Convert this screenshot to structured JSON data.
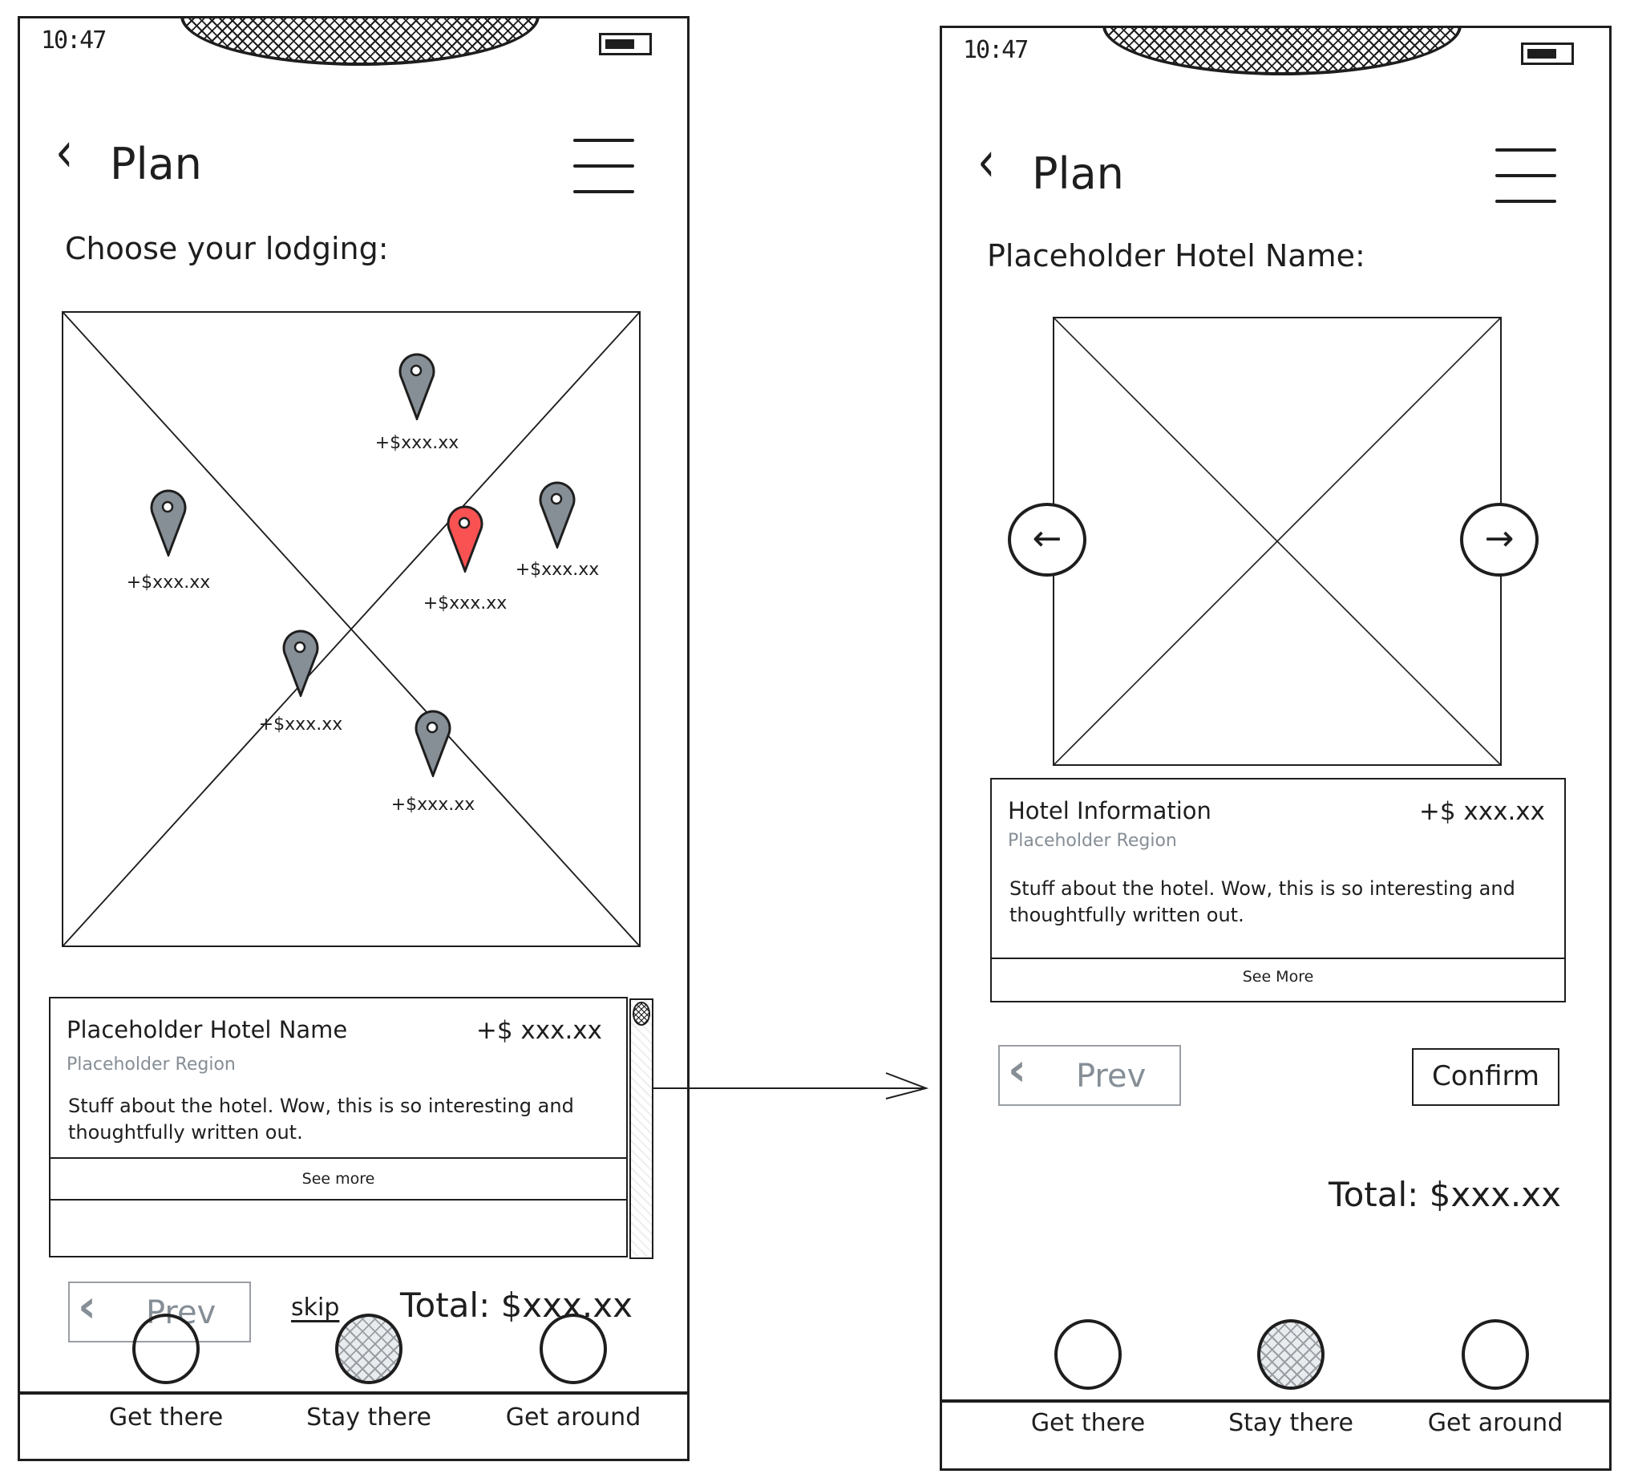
{
  "screens": {
    "left": {
      "status": {
        "time": "10:47"
      },
      "header": {
        "back_icon": "chevron-left-icon",
        "title": "Plan",
        "menu_icon": "hamburger-menu-icon"
      },
      "subtitle": "Choose your lodging:",
      "map": {
        "placeholder": "image-placeholder",
        "pins": [
          {
            "label": "+$xxx.xx",
            "selected": false
          },
          {
            "label": "+$xxx.xx",
            "selected": false
          },
          {
            "label": "+$xxx.xx",
            "selected": true
          },
          {
            "label": "+$xxx.xx",
            "selected": false
          },
          {
            "label": "+$xxx.xx",
            "selected": false
          },
          {
            "label": "+$xxx.xx",
            "selected": false
          }
        ]
      },
      "card": {
        "title": "Placeholder Hotel Name",
        "price": "+$ xxx.xx",
        "region": "Placeholder Region",
        "description": "Stuff about the hotel. Wow, this is so interesting and thoughtfully written out.",
        "link": "See more"
      },
      "footer": {
        "prev_label": "Prev",
        "skip_label": "skip",
        "total": "Total: $xxx.xx"
      },
      "tabs": [
        {
          "label": "Get there",
          "active": false
        },
        {
          "label": "Stay there",
          "active": true
        },
        {
          "label": "Get around",
          "active": false
        }
      ]
    },
    "right": {
      "status": {
        "time": "10:47"
      },
      "header": {
        "back_icon": "chevron-left-icon",
        "title": "Plan",
        "menu_icon": "hamburger-menu-icon"
      },
      "subtitle": "Placeholder Hotel Name:",
      "gallery": {
        "placeholder": "image-placeholder",
        "prev_icon": "arrow-left-icon",
        "next_icon": "arrow-right-icon"
      },
      "card": {
        "title": "Hotel Information",
        "price": "+$ xxx.xx",
        "region": "Placeholder Region",
        "description": "Stuff about the hotel. Wow, this is so interesting and thoughtfully written out.",
        "link": "See More"
      },
      "footer": {
        "prev_label": "Prev",
        "confirm_label": "Confirm",
        "total": "Total: $xxx.xx"
      },
      "tabs": [
        {
          "label": "Get there",
          "active": false
        },
        {
          "label": "Stay there",
          "active": true
        },
        {
          "label": "Get around",
          "active": false
        }
      ]
    }
  },
  "colors": {
    "ink": "#1e1e1e",
    "muted": "#868e96",
    "pin": "#868e96",
    "pin_selected": "#fa5252"
  },
  "flow": {
    "from": "left.card",
    "to": "right",
    "icon": "flow-arrow-icon"
  }
}
